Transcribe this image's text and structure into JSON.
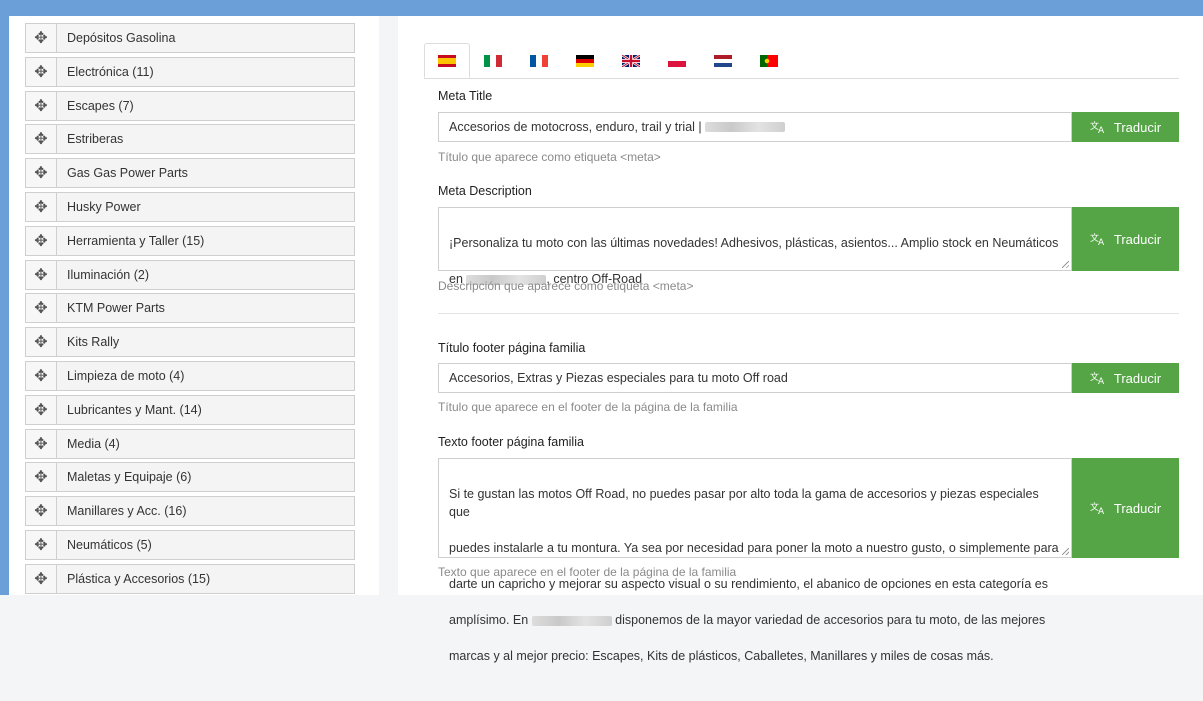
{
  "categories": [
    {
      "label": "Depósitos Gasolina"
    },
    {
      "label": "Electrónica (11)"
    },
    {
      "label": "Escapes (7)"
    },
    {
      "label": "Estriberas"
    },
    {
      "label": "Gas Gas Power Parts"
    },
    {
      "label": "Husky Power"
    },
    {
      "label": "Herramienta y Taller (15)"
    },
    {
      "label": "Iluminación (2)"
    },
    {
      "label": "KTM Power Parts"
    },
    {
      "label": "Kits Rally"
    },
    {
      "label": "Limpieza de moto (4)"
    },
    {
      "label": "Lubricantes y Mant. (14)"
    },
    {
      "label": "Media (4)"
    },
    {
      "label": "Maletas y Equipaje (6)"
    },
    {
      "label": "Manillares y Acc. (16)"
    },
    {
      "label": "Neumáticos (5)"
    },
    {
      "label": "Plástica y Accesorios (15)"
    }
  ],
  "languages": [
    "es",
    "it",
    "fr",
    "de",
    "en",
    "pl",
    "nl",
    "pt"
  ],
  "form": {
    "translate_label": "Traducir",
    "meta_title": {
      "label": "Meta Title",
      "value": "Accesorios de motocross, enduro, trail y trial |",
      "help": "Título que aparece como etiqueta <meta>"
    },
    "meta_description": {
      "label": "Meta Description",
      "value_line1": "¡Personaliza tu moto con las últimas novedades! Adhesivos, plásticas, asientos... Amplio stock en Neumáticos",
      "value_line2_pre": "en",
      "value_line2_post": ", centro Off-Road",
      "help": "Descripción que aparece como etiqueta <meta>"
    },
    "footer_title": {
      "label": "Título footer página familia",
      "value": "Accesorios, Extras y Piezas especiales para tu moto Off road",
      "help": "Título que aparece en el footer de la página de la familia"
    },
    "footer_text": {
      "label": "Texto footer página familia",
      "line1": "Si te gustan las motos Off Road, no puedes pasar por alto toda la gama de accesorios y piezas especiales que",
      "line2": "puedes instalarle a tu montura. Ya sea por necesidad para poner la moto a nuestro gusto, o simplemente para",
      "line3": "darte un capricho y mejorar su aspecto visual o su rendimiento, el abanico de opciones en esta categoría es",
      "line4_pre": "amplísimo. En",
      "line4_post": "disponemos de la mayor variedad de accesorios para tu moto, de las mejores",
      "line5": "marcas y al mejor precio: Escapes, Kits de plásticos, Caballetes, Manillares y miles de cosas más.",
      "help": "Texto que aparece en el footer de la página de la familia"
    }
  }
}
